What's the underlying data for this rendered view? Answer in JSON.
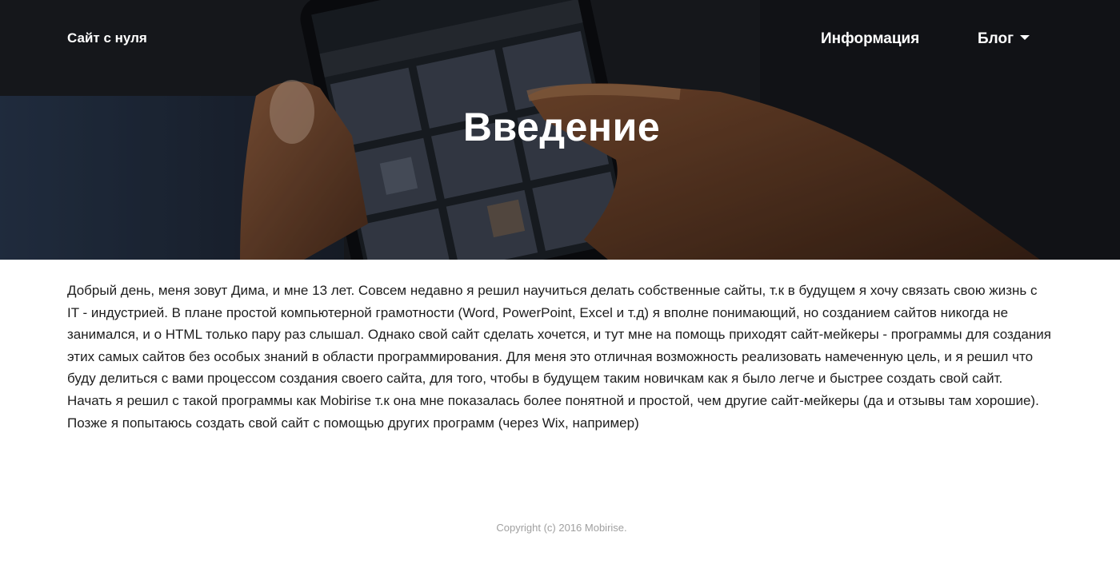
{
  "nav": {
    "brand": "Сайт с нуля",
    "items": [
      {
        "label": "Информация"
      },
      {
        "label": "Блог"
      }
    ]
  },
  "hero": {
    "title": "Введение",
    "image_icon": "hands-holding-phone-photo"
  },
  "content": {
    "paragraphs": [
      "Добрый день, меня зовут Дима, и мне 13 лет. Совсем недавно я решил научиться делать собственные сайты, т.к в будущем я хочу связать свою жизнь с IT - индустрией. В плане простой компьютерной грамотности (Word, PowerPoint, Excel и т.д) я вполне понимающий, но созданием сайтов никогда не занимался, и о HTML только пару раз слышал. Однако свой сайт сделать хочется, и тут мне на помощь приходят сайт-мейкеры - программы для создания этих самых сайтов без особых знаний в области программирования. Для меня это отличная возможность реализовать намеченную цель, и я решил что буду делиться с вами процессом создания своего сайта, для того, чтобы в будущем таким новичкам как я было легче и быстрее создать свой сайт.",
      "Начать я решил с такой программы как Mobirise т.к она мне показалась более понятной и простой, чем другие сайт-мейкеры (да и отзывы там хорошие). Позже я попытаюсь создать свой сайт с помощью других программ (через Wix, например)"
    ]
  },
  "footer": {
    "copyright": "Copyright (c) 2016 Mobirise."
  },
  "colors": {
    "hero_text": "#ffffff",
    "body_text": "#1d1d1d",
    "footer_text": "#a0a0a0"
  }
}
